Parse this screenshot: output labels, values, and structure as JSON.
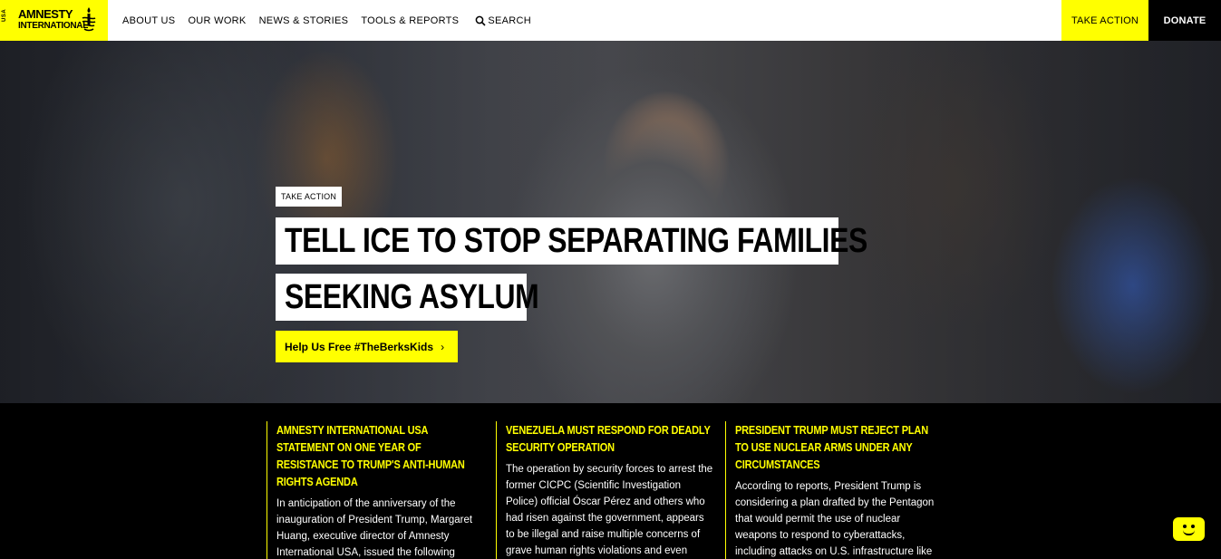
{
  "header": {
    "logo": {
      "country": "USA",
      "line1": "AMNESTY",
      "line2": "INTERNATIONAL"
    },
    "nav": [
      {
        "label": "ABOUT US"
      },
      {
        "label": "OUR WORK"
      },
      {
        "label": "NEWS & STORIES"
      },
      {
        "label": "TOOLS & REPORTS"
      }
    ],
    "search_label": "SEARCH",
    "take_action_label": "TAKE ACTION",
    "donate_label": "DONATE"
  },
  "hero": {
    "tag": "TAKE ACTION",
    "title_line1": "TELL ICE TO STOP SEPARATING FAMILIES",
    "title_line2": "SEEKING ASYLUM",
    "cta_label": "Help Us Free #TheBerksKids",
    "cta_icon": "chevron-right-icon"
  },
  "news": [
    {
      "title": "AMNESTY INTERNATIONAL USA STATEMENT ON ONE YEAR OF RESISTANCE TO TRUMP'S ANTI-HUMAN RIGHTS AGENDA",
      "body": "In anticipation of the anniversary of the inauguration of President Trump, Margaret Huang, executive director of Amnesty International USA, issued the following statement:"
    },
    {
      "title": "VENEZUELA MUST RESPOND FOR DEADLY SECURITY OPERATION",
      "body": "The operation by security forces to arrest the former CICPC (Scientific Investigation Police) official Óscar Pérez and others who had risen against the government, appears to be illegal and raise multiple concerns of grave human rights violations and even"
    },
    {
      "title": "PRESIDENT TRUMP MUST REJECT PLAN TO USE NUCLEAR ARMS UNDER ANY CIRCUMSTANCES",
      "body": "According to reports, President Trump is considering a plan drafted by the Pentagon that would permit the use of nuclear weapons to respond to cyberattacks, including attacks on U.S. infrastructure like"
    }
  ],
  "colors": {
    "accent": "#ffff00",
    "dark": "#000000",
    "light": "#ffffff"
  }
}
